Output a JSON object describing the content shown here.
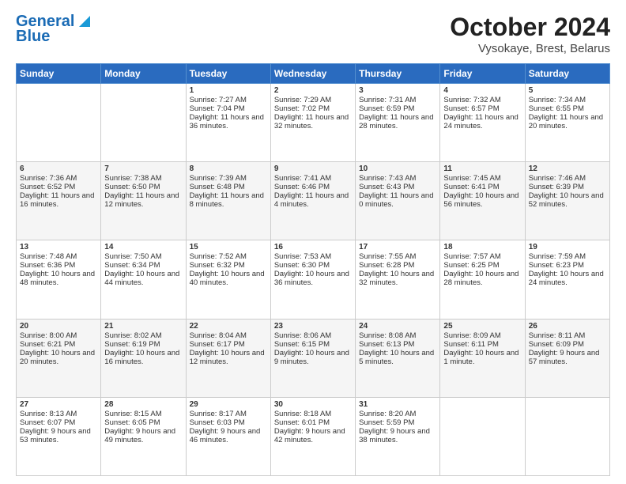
{
  "header": {
    "logo_line1": "General",
    "logo_line2": "Blue",
    "title": "October 2024",
    "subtitle": "Vysokaye, Brest, Belarus"
  },
  "days_of_week": [
    "Sunday",
    "Monday",
    "Tuesday",
    "Wednesday",
    "Thursday",
    "Friday",
    "Saturday"
  ],
  "weeks": [
    [
      {
        "day": "",
        "text": ""
      },
      {
        "day": "",
        "text": ""
      },
      {
        "day": "1",
        "text": "Sunrise: 7:27 AM\nSunset: 7:04 PM\nDaylight: 11 hours and 36 minutes."
      },
      {
        "day": "2",
        "text": "Sunrise: 7:29 AM\nSunset: 7:02 PM\nDaylight: 11 hours and 32 minutes."
      },
      {
        "day": "3",
        "text": "Sunrise: 7:31 AM\nSunset: 6:59 PM\nDaylight: 11 hours and 28 minutes."
      },
      {
        "day": "4",
        "text": "Sunrise: 7:32 AM\nSunset: 6:57 PM\nDaylight: 11 hours and 24 minutes."
      },
      {
        "day": "5",
        "text": "Sunrise: 7:34 AM\nSunset: 6:55 PM\nDaylight: 11 hours and 20 minutes."
      }
    ],
    [
      {
        "day": "6",
        "text": "Sunrise: 7:36 AM\nSunset: 6:52 PM\nDaylight: 11 hours and 16 minutes."
      },
      {
        "day": "7",
        "text": "Sunrise: 7:38 AM\nSunset: 6:50 PM\nDaylight: 11 hours and 12 minutes."
      },
      {
        "day": "8",
        "text": "Sunrise: 7:39 AM\nSunset: 6:48 PM\nDaylight: 11 hours and 8 minutes."
      },
      {
        "day": "9",
        "text": "Sunrise: 7:41 AM\nSunset: 6:46 PM\nDaylight: 11 hours and 4 minutes."
      },
      {
        "day": "10",
        "text": "Sunrise: 7:43 AM\nSunset: 6:43 PM\nDaylight: 11 hours and 0 minutes."
      },
      {
        "day": "11",
        "text": "Sunrise: 7:45 AM\nSunset: 6:41 PM\nDaylight: 10 hours and 56 minutes."
      },
      {
        "day": "12",
        "text": "Sunrise: 7:46 AM\nSunset: 6:39 PM\nDaylight: 10 hours and 52 minutes."
      }
    ],
    [
      {
        "day": "13",
        "text": "Sunrise: 7:48 AM\nSunset: 6:36 PM\nDaylight: 10 hours and 48 minutes."
      },
      {
        "day": "14",
        "text": "Sunrise: 7:50 AM\nSunset: 6:34 PM\nDaylight: 10 hours and 44 minutes."
      },
      {
        "day": "15",
        "text": "Sunrise: 7:52 AM\nSunset: 6:32 PM\nDaylight: 10 hours and 40 minutes."
      },
      {
        "day": "16",
        "text": "Sunrise: 7:53 AM\nSunset: 6:30 PM\nDaylight: 10 hours and 36 minutes."
      },
      {
        "day": "17",
        "text": "Sunrise: 7:55 AM\nSunset: 6:28 PM\nDaylight: 10 hours and 32 minutes."
      },
      {
        "day": "18",
        "text": "Sunrise: 7:57 AM\nSunset: 6:25 PM\nDaylight: 10 hours and 28 minutes."
      },
      {
        "day": "19",
        "text": "Sunrise: 7:59 AM\nSunset: 6:23 PM\nDaylight: 10 hours and 24 minutes."
      }
    ],
    [
      {
        "day": "20",
        "text": "Sunrise: 8:00 AM\nSunset: 6:21 PM\nDaylight: 10 hours and 20 minutes."
      },
      {
        "day": "21",
        "text": "Sunrise: 8:02 AM\nSunset: 6:19 PM\nDaylight: 10 hours and 16 minutes."
      },
      {
        "day": "22",
        "text": "Sunrise: 8:04 AM\nSunset: 6:17 PM\nDaylight: 10 hours and 12 minutes."
      },
      {
        "day": "23",
        "text": "Sunrise: 8:06 AM\nSunset: 6:15 PM\nDaylight: 10 hours and 9 minutes."
      },
      {
        "day": "24",
        "text": "Sunrise: 8:08 AM\nSunset: 6:13 PM\nDaylight: 10 hours and 5 minutes."
      },
      {
        "day": "25",
        "text": "Sunrise: 8:09 AM\nSunset: 6:11 PM\nDaylight: 10 hours and 1 minute."
      },
      {
        "day": "26",
        "text": "Sunrise: 8:11 AM\nSunset: 6:09 PM\nDaylight: 9 hours and 57 minutes."
      }
    ],
    [
      {
        "day": "27",
        "text": "Sunrise: 8:13 AM\nSunset: 6:07 PM\nDaylight: 9 hours and 53 minutes."
      },
      {
        "day": "28",
        "text": "Sunrise: 8:15 AM\nSunset: 6:05 PM\nDaylight: 9 hours and 49 minutes."
      },
      {
        "day": "29",
        "text": "Sunrise: 8:17 AM\nSunset: 6:03 PM\nDaylight: 9 hours and 46 minutes."
      },
      {
        "day": "30",
        "text": "Sunrise: 8:18 AM\nSunset: 6:01 PM\nDaylight: 9 hours and 42 minutes."
      },
      {
        "day": "31",
        "text": "Sunrise: 8:20 AM\nSunset: 5:59 PM\nDaylight: 9 hours and 38 minutes."
      },
      {
        "day": "",
        "text": ""
      },
      {
        "day": "",
        "text": ""
      }
    ]
  ]
}
